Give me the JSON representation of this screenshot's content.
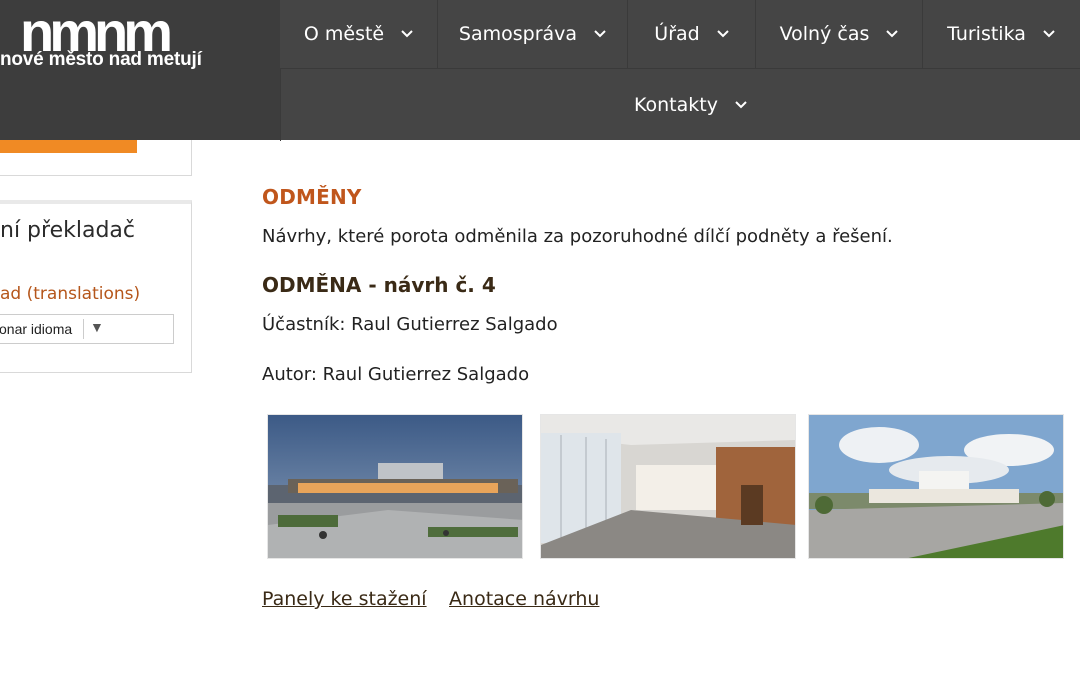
{
  "site": {
    "logo_mark": "nmnm",
    "logo_text": "nové město nad metují"
  },
  "nav": {
    "items": [
      {
        "label": "O městě"
      },
      {
        "label": "Samospráva"
      },
      {
        "label": "Úřad"
      },
      {
        "label": "Volný čas"
      },
      {
        "label": "Turistika"
      },
      {
        "label": "Kontakty"
      }
    ]
  },
  "sidebar": {
    "translator_title": "ní překladač",
    "translator_link": "ad (translations)",
    "language_select": {
      "value": "onar idioma"
    }
  },
  "content": {
    "section_title": "ODMĚNY",
    "section_desc": "Návrhy, které porota odměnila za pozoruhodné dílčí podněty a řešení.",
    "award_title": "ODMĚNA - návrh č. 4",
    "participant": "Účastník: Raul Gutierrez Salgado",
    "author": "Autor: Raul Gutierrez Salgado",
    "gallery": [
      "exterior-dusk-render",
      "interior-lobby-render",
      "exterior-day-render"
    ],
    "links": [
      "Panely ke stažení",
      "Anotace návrhu"
    ]
  },
  "colors": {
    "header_bg": "#454545",
    "accent_orange": "#f08a24",
    "title_orange": "#c0561c",
    "link_brown": "#3a2a16"
  }
}
